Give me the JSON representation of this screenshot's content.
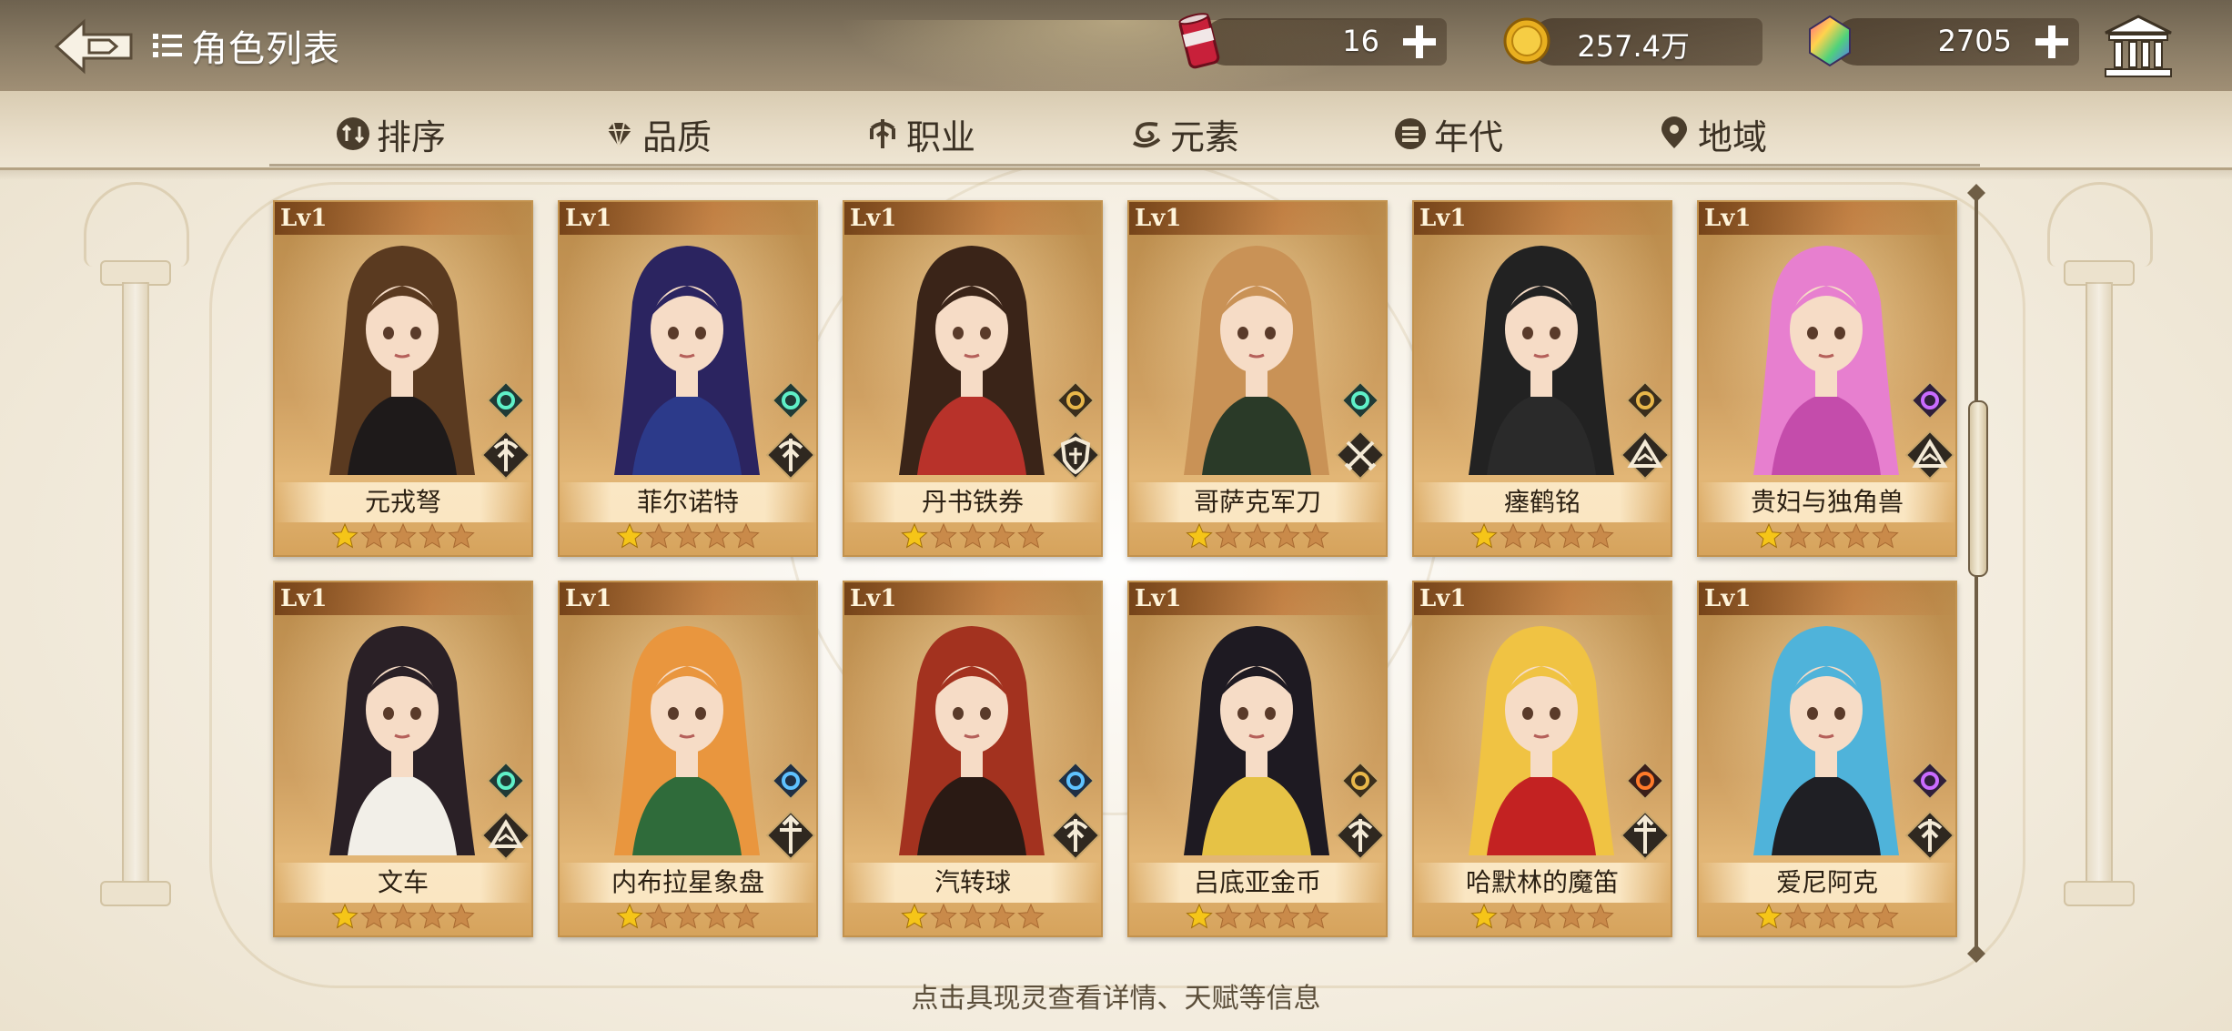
{
  "header": {
    "back_icon": "back-arrow-icon",
    "title_icon": "list-icon",
    "title": "角色列表"
  },
  "resources": [
    {
      "name": "stamina-can",
      "icon": "can-icon",
      "value": "16",
      "add_icon": "plus-icon"
    },
    {
      "name": "gold-coin",
      "icon": "coin-icon",
      "value": "257.4万",
      "add_icon": "plus-icon"
    },
    {
      "name": "gem",
      "icon": "gem-icon",
      "value": "2705",
      "add_icon": "plus-icon"
    }
  ],
  "museum_icon": "museum-icon",
  "filters": [
    {
      "label": "排序",
      "icon": "sort-icon"
    },
    {
      "label": "品质",
      "icon": "gem-quality-icon"
    },
    {
      "label": "职业",
      "icon": "class-icon"
    },
    {
      "label": "元素",
      "icon": "element-icon"
    },
    {
      "label": "年代",
      "icon": "era-icon"
    },
    {
      "label": "地域",
      "icon": "location-pin-icon"
    }
  ],
  "cards": [
    {
      "level": "Lv1",
      "name": "元戎弩",
      "element": "wind",
      "cls": "archer",
      "stars": 1,
      "hair": "#5a3a20",
      "outfit": "#1e1a1a"
    },
    {
      "level": "Lv1",
      "name": "菲尔诺特",
      "element": "wind",
      "cls": "archer",
      "stars": 1,
      "hair": "#2b2460",
      "outfit": "#2c3a8a"
    },
    {
      "level": "Lv1",
      "name": "丹书铁券",
      "element": "earth",
      "cls": "shield",
      "stars": 1,
      "hair": "#3a2418",
      "outfit": "#b8322a"
    },
    {
      "level": "Lv1",
      "name": "哥萨克军刀",
      "element": "wind",
      "cls": "swords",
      "stars": 1,
      "hair": "#c99256",
      "outfit": "#2a3a28"
    },
    {
      "level": "Lv1",
      "name": "瘗鹤铭",
      "element": "earth",
      "cls": "book",
      "stars": 1,
      "hair": "#222222",
      "outfit": "#2a2a2a"
    },
    {
      "level": "Lv1",
      "name": "贵妇与独角兽",
      "element": "thunder",
      "cls": "book",
      "stars": 1,
      "hair": "#e77fcf",
      "outfit": "#c44cab"
    },
    {
      "level": "Lv1",
      "name": "文车",
      "element": "wind",
      "cls": "book",
      "stars": 1,
      "hair": "#2a2026",
      "outfit": "#f2efe8"
    },
    {
      "level": "Lv1",
      "name": "内布拉星象盘",
      "element": "water",
      "cls": "cross",
      "stars": 1,
      "hair": "#e9963e",
      "outfit": "#2f6b3a"
    },
    {
      "level": "Lv1",
      "name": "汽转球",
      "element": "water",
      "cls": "archer",
      "stars": 1,
      "hair": "#a3321f",
      "outfit": "#2a1a14"
    },
    {
      "level": "Lv1",
      "name": "吕底亚金币",
      "element": "earth",
      "cls": "archer",
      "stars": 1,
      "hair": "#1e1a22",
      "outfit": "#e6c245"
    },
    {
      "level": "Lv1",
      "name": "哈默林的魔笛",
      "element": "fire",
      "cls": "cross",
      "stars": 1,
      "hair": "#f0c343",
      "outfit": "#c32222"
    },
    {
      "level": "Lv1",
      "name": "爱尼阿克",
      "element": "thunder",
      "cls": "archer",
      "stars": 1,
      "hair": "#4fb3da",
      "outfit": "#1f1f24"
    }
  ],
  "hint": "点击具现灵查看详情、天赋等信息",
  "colors": {
    "accent": "#c2924e",
    "star_active": "#f5c518",
    "star_inactive": "#c98a4a"
  }
}
